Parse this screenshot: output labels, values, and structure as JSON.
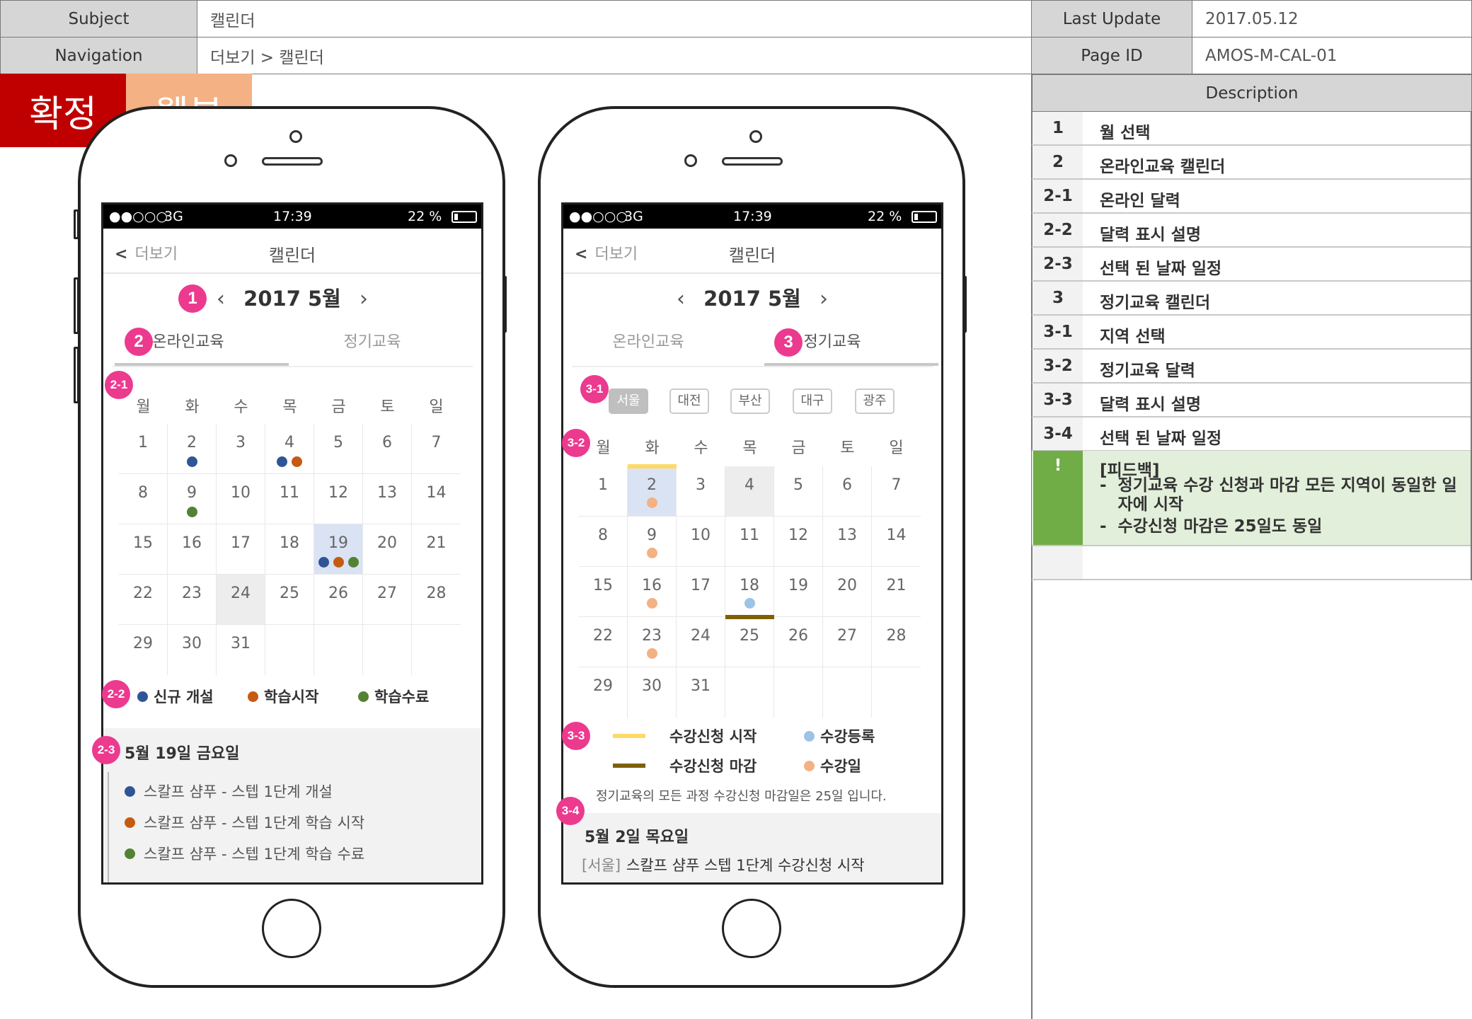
{
  "header": {
    "subject_label": "Subject",
    "subject_value": "캘린더",
    "navigation_label": "Navigation",
    "navigation_value": "더보기 > 캘린더",
    "last_update_label": "Last Update",
    "last_update_value": "2017.05.12",
    "page_id_label": "Page ID",
    "page_id_value": "AMOS-M-CAL-01"
  },
  "badges": {
    "confirmed": "확정",
    "webview": "웹뷰"
  },
  "phones": {
    "status": {
      "signal": "●●○○○",
      "network": "3G",
      "time": "17:39",
      "battery": "22 %"
    },
    "back": "<",
    "back_label": "더보기",
    "title": "캘린더",
    "month": "2017 5월",
    "prev": "‹",
    "next": "›",
    "tab_online": "온라인교육",
    "tab_regular": "정기교육",
    "weekdays": [
      "월",
      "화",
      "수",
      "목",
      "금",
      "토",
      "일"
    ]
  },
  "phone1": {
    "days": [
      [
        "1",
        "2",
        "3",
        "4",
        "5",
        "6",
        "7"
      ],
      [
        "8",
        "9",
        "10",
        "11",
        "12",
        "13",
        "14"
      ],
      [
        "15",
        "16",
        "17",
        "18",
        "19",
        "20",
        "21"
      ],
      [
        "22",
        "23",
        "24",
        "25",
        "26",
        "27",
        "28"
      ],
      [
        "29",
        "30",
        "31",
        "",
        "",
        "",
        ""
      ]
    ],
    "legend": [
      "신규 개설",
      "학습시작",
      "학습수료"
    ],
    "detail_title": "5월 19일 금요일",
    "events": [
      "스칼프 샴푸 - 스텝 1단계 개설",
      "스칼프 샴푸 - 스텝 1단계 학습 시작",
      "스칼프 샴푸 - 스텝 1단계 학습 수료"
    ]
  },
  "phone2": {
    "regions": [
      "서울",
      "대전",
      "부산",
      "대구",
      "광주"
    ],
    "days": [
      [
        "1",
        "2",
        "3",
        "4",
        "5",
        "6",
        "7"
      ],
      [
        "8",
        "9",
        "10",
        "11",
        "12",
        "13",
        "14"
      ],
      [
        "15",
        "16",
        "17",
        "18",
        "19",
        "20",
        "21"
      ],
      [
        "22",
        "23",
        "24",
        "25",
        "26",
        "27",
        "28"
      ],
      [
        "29",
        "30",
        "31",
        "",
        "",
        "",
        ""
      ]
    ],
    "legend": [
      "수강신청 시작",
      "수강등록",
      "수강신청 마감",
      "수강일"
    ],
    "notice": "정기교육의 모든 과정 수강신청 마감일은 25일 입니다.",
    "detail_title": "5월 2일 목요일",
    "event_region": "[서울]",
    "event_text": "스칼프 샴푸 스텝 1단계 수강신청 시작"
  },
  "markers": {
    "m1": "1",
    "m2": "2",
    "m3": "3",
    "m21": "2-1",
    "m22": "2-2",
    "m23": "2-3",
    "m31": "3-1",
    "m32": "3-2",
    "m33": "3-3",
    "m34": "3-4"
  },
  "description": {
    "header": "Description",
    "rows": [
      {
        "num": "1",
        "text": "월 선택"
      },
      {
        "num": "2",
        "text": "온라인교육 캘린더"
      },
      {
        "num": "2-1",
        "text": "온라인 달력"
      },
      {
        "num": "2-2",
        "text": "달력 표시 설명"
      },
      {
        "num": "2-3",
        "text": "선택 된 날짜 일정"
      },
      {
        "num": "3",
        "text": "정기교육 캘린더"
      },
      {
        "num": "3-1",
        "text": "지역 선택"
      },
      {
        "num": "3-2",
        "text": "정기교육 달력"
      },
      {
        "num": "3-3",
        "text": "달력 표시 설명"
      },
      {
        "num": "3-4",
        "text": "선택 된 날짜 일정"
      }
    ],
    "feedback": {
      "num": "!",
      "title": "[피드백]",
      "items": [
        "정기교육 수강 신청과 마감 모든 지역이 동일한 일자에 시작",
        "수강신청 마감은 25일도 동일"
      ],
      "bullet": "-"
    }
  },
  "colors": {
    "badge_confirmed": "#c00000",
    "badge_webview": "#f4b183",
    "marker": "#ec3a8f",
    "dot_new": "#2f5597",
    "dot_start": "#c55a11",
    "dot_complete": "#548235",
    "bar_apply_start": "#ffd966",
    "bar_apply_end": "#7f6000",
    "dot_enroll": "#9dc3e6",
    "dot_class": "#f4b183",
    "feedback_bg": "#e2efda",
    "feedback_num_bg": "#70ad47"
  }
}
